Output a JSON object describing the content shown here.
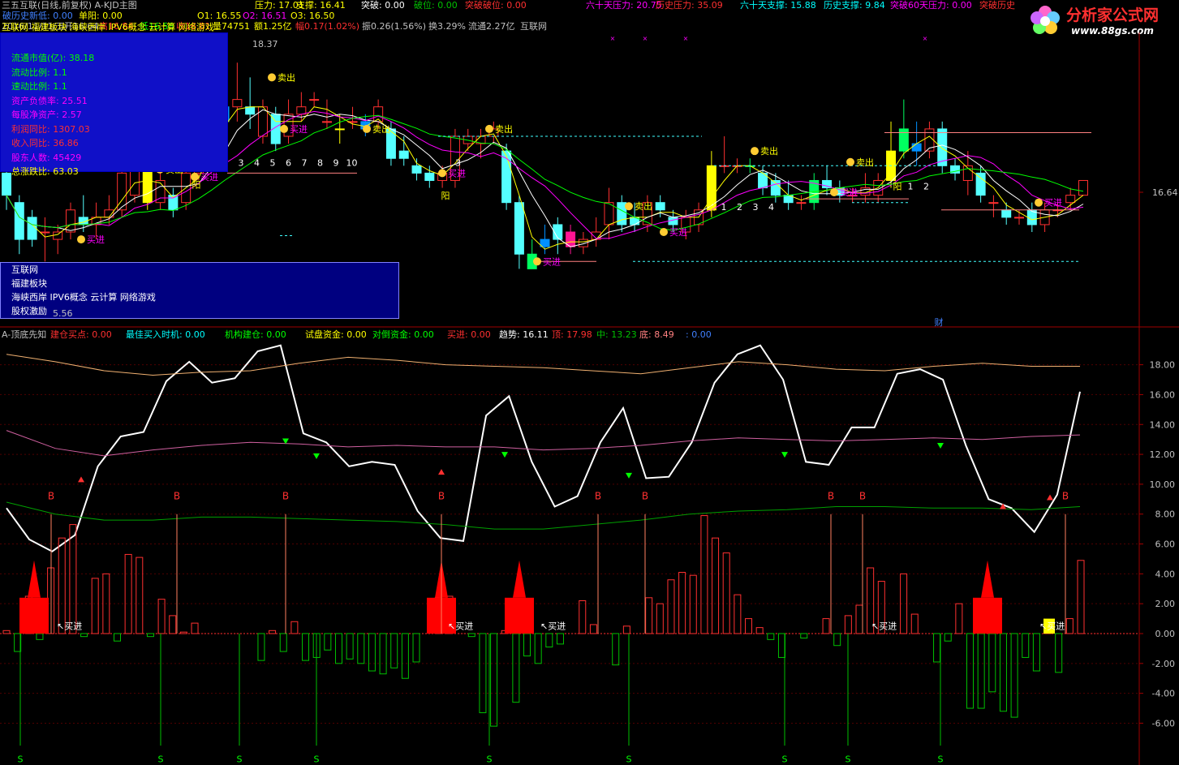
{
  "colors": {
    "up": "#ff3030",
    "down": "#00ffff",
    "yellow": "#ffff00",
    "white": "#ffffff",
    "green": "#00ff00",
    "magenta": "#ff00ff",
    "label_cyan": "#00c0c0"
  },
  "header": {
    "row1_left": [
      {
        "text": "三五互联(日线,前复权) A-KJD主图",
        "color": "#c0c0c0"
      }
    ],
    "row1_right": [
      {
        "text": "压力: 17.01",
        "color": "#ffff00"
      },
      {
        "text": "支撑: 16.41",
        "color": "#ffff00"
      },
      {
        "text": "突破: 0.00",
        "color": "#ffffff"
      },
      {
        "text": "破位: 0.00",
        "color": "#00c000"
      },
      {
        "text": "突破破位: 0.00",
        "color": "#ff3030"
      },
      {
        "text": "六十天压力: 20.75",
        "color": "#ff00ff"
      },
      {
        "text": "历史压力: 35.09",
        "color": "#ff3030"
      },
      {
        "text": "六十天支撑: 15.88",
        "color": "#00ffff"
      },
      {
        "text": "历史支撑: 9.84",
        "color": "#00ffff"
      },
      {
        "text": "突破60天压力: 0.00",
        "color": "#ff00ff"
      },
      {
        "text": "突破历史",
        "color": "#ff3030"
      }
    ],
    "row2": [
      {
        "text": "破历史新低: 0.00",
        "color": "#4080ff"
      },
      {
        "text": "单阳: 0.00",
        "color": "#ffff00"
      },
      {
        "text": "O1: 16.55",
        "color": "#ffff00"
      },
      {
        "text": "O2: 16.51",
        "color": "#ff00ff"
      },
      {
        "text": "O3: 16.50",
        "color": "#ffff00"
      }
    ],
    "row3": [
      {
        "text": "2016/11/11/五",
        "color": "#c0c0c0"
      },
      {
        "text": "开16.64",
        "color": "#c0c0c0"
      },
      {
        "text": "高16.84",
        "color": "#ff3030"
      },
      {
        "text": "低16.58",
        "color": "#00ff00"
      },
      {
        "text": "收16.81",
        "color": "#ff3030"
      },
      {
        "text": "量74751",
        "color": "#ffff00"
      },
      {
        "text": "额1.25亿",
        "color": "#ffff00"
      },
      {
        "text": "幅0.17(1.02%)",
        "color": "#ff3030"
      },
      {
        "text": "振0.26(1.56%)",
        "color": "#c0c0c0"
      },
      {
        "text": "换3.29%",
        "color": "#c0c0c0"
      },
      {
        "text": "流通2.27亿",
        "color": "#c0c0c0"
      },
      {
        "text": "互联网",
        "color": "#c0c0c0"
      }
    ],
    "concepts_line": "互联网 福建板块 海峡西岸 IPV6概念 云计算 网络游戏",
    "logo_main": "分析家公式网",
    "logo_url": "www.88gs.com"
  },
  "fin_panel": [
    {
      "label": "流通市值(亿): 38.18",
      "color": "#00ff00"
    },
    {
      "label": "流动比例: 1.1",
      "color": "#00ff00"
    },
    {
      "label": "速动比例: 1.1",
      "color": "#00ff00"
    },
    {
      "label": "资产负债率: 25.51",
      "color": "#ff00ff"
    },
    {
      "label": "每股净资产: 2.57",
      "color": "#ff00ff"
    },
    {
      "label": "利润同比: 1307.03",
      "color": "#ff3030"
    },
    {
      "label": "收入同比: 36.86",
      "color": "#ff3030"
    },
    {
      "label": "股东人数: 45429",
      "color": "#ff00ff"
    },
    {
      "label": "总涨跌比: 63.03",
      "color": "#ffff00"
    }
  ],
  "stock_panel": [
    "互联网",
    "福建板块",
    "海峡西岸 IPV6概念 云计算 网络游戏",
    "股权激励"
  ],
  "stock_panel_value": "5.56",
  "price_axis": {
    "labels": [
      "16.64"
    ],
    "ymin": 14.8,
    "ymax": 18.7
  },
  "price_marks": {
    "high_label": "18.37",
    "buy": "买进",
    "sell": "卖出",
    "yang": "阳",
    "cai": "财",
    "seq": [
      "1",
      "2",
      "3",
      "4",
      "5",
      "6",
      "7",
      "8",
      "9",
      "10"
    ]
  },
  "indicator_header": [
    {
      "text": "A-顶底先知",
      "color": "#c0c0c0"
    },
    {
      "text": "建仓买点: 0.00",
      "color": "#ff3030"
    },
    {
      "text": "最佳买入时机: 0.00",
      "color": "#00ffff"
    },
    {
      "text": "机构建仓: 0.00",
      "color": "#00ff00"
    },
    {
      "text": "试盘资金: 0.00",
      "color": "#ffff00"
    },
    {
      "text": "对倒资金: 0.00",
      "color": "#00ff00"
    },
    {
      "text": "买进: 0.00",
      "color": "#ff3030"
    },
    {
      "text": "趋势: 16.11",
      "color": "#ffffff"
    },
    {
      "text": "顶: 17.98",
      "color": "#ff3030"
    },
    {
      "text": "中: 13.23",
      "color": "#00c000"
    },
    {
      "text": "底: 8.49",
      "color": "#ff8080"
    },
    {
      "text": ": 0.00",
      "color": "#4080ff"
    }
  ],
  "indicator_axis": {
    "labels": [
      "18.00",
      "16.00",
      "14.00",
      "12.00",
      "10.00",
      "8.00",
      "6.00",
      "4.00",
      "2.00",
      "0.00",
      "-2.00",
      "-4.00",
      "-6.00"
    ],
    "ymin": -8.8,
    "ymax": 19.5
  },
  "signals": {
    "B": "B",
    "S": "S",
    "buy": "买进"
  }
}
